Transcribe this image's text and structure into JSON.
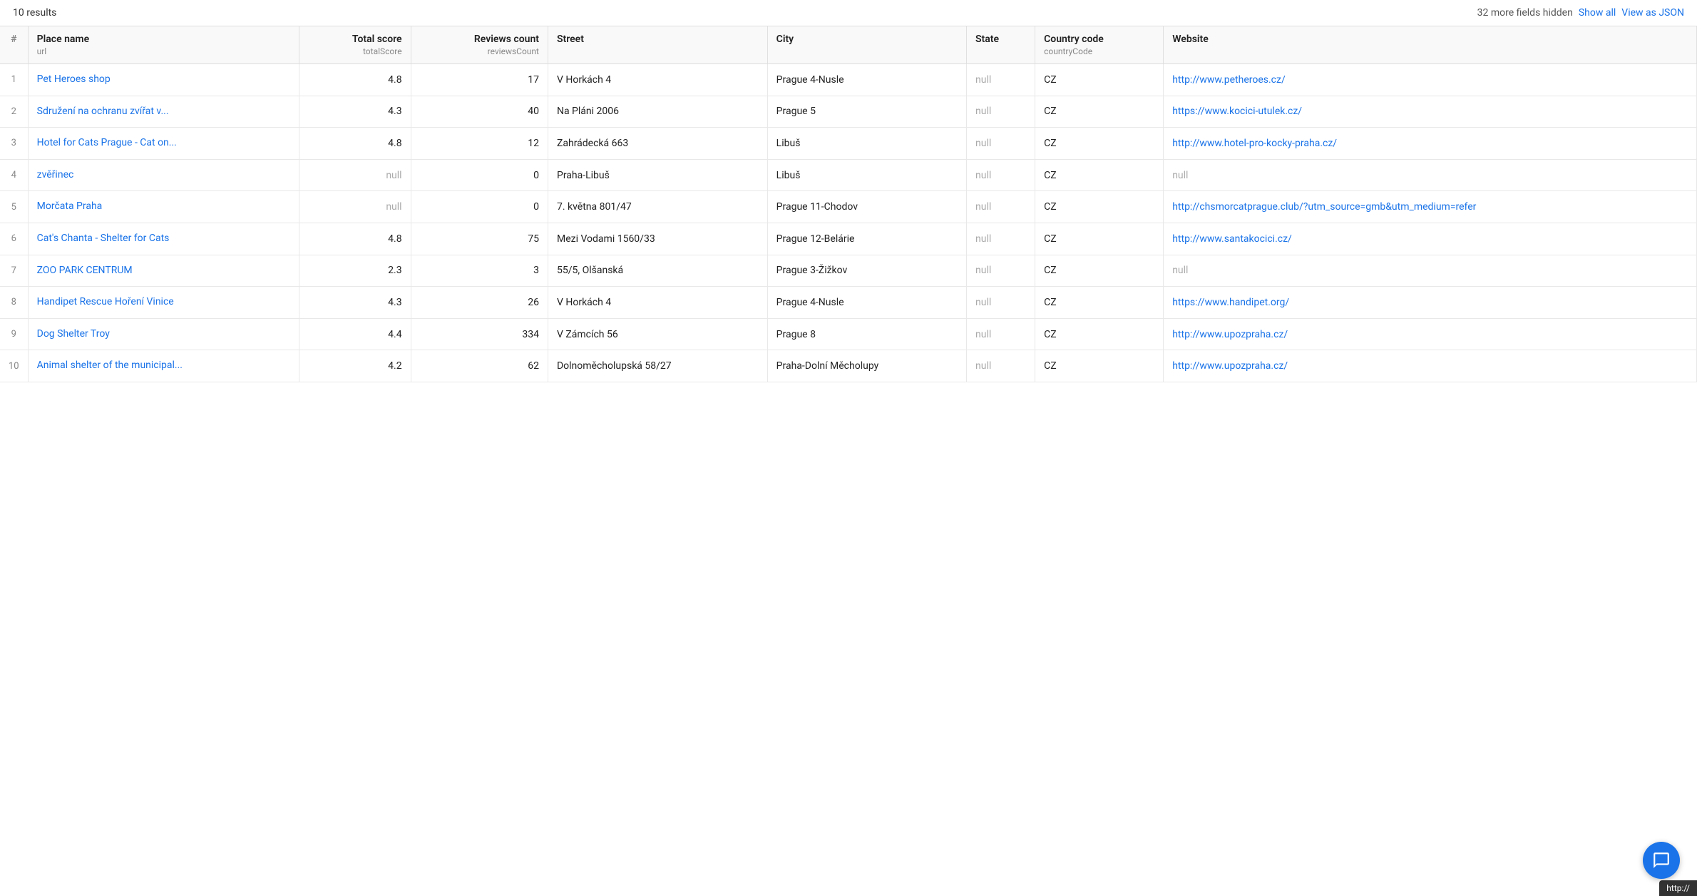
{
  "header": {
    "results_count": "10 results",
    "hidden_fields": "32 more fields hidden",
    "show_all_label": "Show all",
    "view_as_json_label": "View as JSON"
  },
  "columns": [
    {
      "label": "#",
      "sub": ""
    },
    {
      "label": "Place name",
      "sub": "url"
    },
    {
      "label": "Total score",
      "sub": "totalScore"
    },
    {
      "label": "Reviews count",
      "sub": "reviewsCount"
    },
    {
      "label": "Street",
      "sub": ""
    },
    {
      "label": "City",
      "sub": ""
    },
    {
      "label": "State",
      "sub": ""
    },
    {
      "label": "Country code",
      "sub": "countryCode"
    },
    {
      "label": "Website",
      "sub": ""
    }
  ],
  "rows": [
    {
      "index": "1",
      "place_name": "Pet Heroes shop",
      "total_score": "4.8",
      "reviews_count": "17",
      "street": "V Horkách 4",
      "city": "Prague 4-Nusle",
      "state": "null",
      "country_code": "CZ",
      "website": "http://www.petheroes.cz/"
    },
    {
      "index": "2",
      "place_name": "Sdružení na ochranu zvířat v...",
      "total_score": "4.3",
      "reviews_count": "40",
      "street": "Na Pláni 2006",
      "city": "Prague 5",
      "state": "null",
      "country_code": "CZ",
      "website": "https://www.kocici-utulek.cz/"
    },
    {
      "index": "3",
      "place_name": "Hotel for Cats Prague - Cat on...",
      "total_score": "4.8",
      "reviews_count": "12",
      "street": "Zahrádecká 663",
      "city": "Libuš",
      "state": "null",
      "country_code": "CZ",
      "website": "http://www.hotel-pro-kocky-praha.cz/"
    },
    {
      "index": "4",
      "place_name": "zvěřinec",
      "total_score": "null",
      "reviews_count": "0",
      "street": "Praha-Libuš",
      "city": "Libuš",
      "state": "null",
      "country_code": "CZ",
      "website": "null"
    },
    {
      "index": "5",
      "place_name": "Morčata Praha",
      "total_score": "null",
      "reviews_count": "0",
      "street": "7. května 801/47",
      "city": "Prague 11-Chodov",
      "state": "null",
      "country_code": "CZ",
      "website": "http://chsmorcatprague.club/?utm_source=gmb&utm_medium=refer"
    },
    {
      "index": "6",
      "place_name": "Cat's Chanta - Shelter for Cats",
      "total_score": "4.8",
      "reviews_count": "75",
      "street": "Mezi Vodami 1560/33",
      "city": "Prague 12-Belárie",
      "state": "null",
      "country_code": "CZ",
      "website": "http://www.santakocici.cz/"
    },
    {
      "index": "7",
      "place_name": "ZOO PARK CENTRUM",
      "total_score": "2.3",
      "reviews_count": "3",
      "street": "55/5, Olšanská",
      "city": "Prague 3-Žižkov",
      "state": "null",
      "country_code": "CZ",
      "website": "null"
    },
    {
      "index": "8",
      "place_name": "Handipet Rescue Hoření Vinice",
      "total_score": "4.3",
      "reviews_count": "26",
      "street": "V Horkách 4",
      "city": "Prague 4-Nusle",
      "state": "null",
      "country_code": "CZ",
      "website": "https://www.handipet.org/"
    },
    {
      "index": "9",
      "place_name": "Dog Shelter Troy",
      "total_score": "4.4",
      "reviews_count": "334",
      "street": "V Zámcích 56",
      "city": "Prague 8",
      "state": "null",
      "country_code": "CZ",
      "website": "http://www.upozpraha.cz/"
    },
    {
      "index": "10",
      "place_name": "Animal shelter of the municipal...",
      "total_score": "4.2",
      "reviews_count": "62",
      "street": "Dolnoměcholupská 58/27",
      "city": "Praha-Dolní Měcholupy",
      "state": "null",
      "country_code": "CZ",
      "website": "http://www.upozpraha.cz/"
    }
  ],
  "tooltip": "http://",
  "chat_icon": "💬"
}
